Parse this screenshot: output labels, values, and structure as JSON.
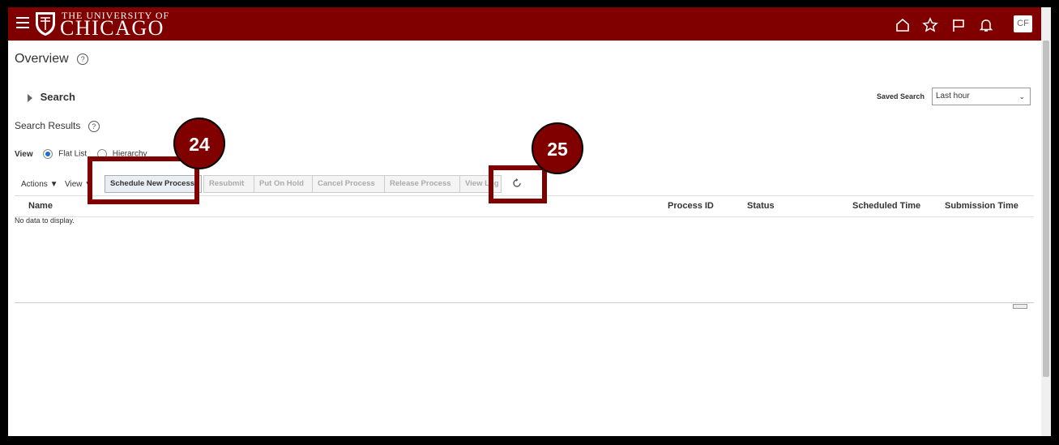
{
  "header": {
    "logo_small": "THE UNIVERSITY OF",
    "logo_big": "CHICAGO",
    "icons": [
      "home-icon",
      "star-icon",
      "flag-icon",
      "bell-icon"
    ],
    "avatar_initials": "CF",
    "brand_color": "#800000"
  },
  "page": {
    "title": "Overview",
    "help": "?"
  },
  "search": {
    "label": "Search",
    "saved_search_label": "Saved Search",
    "saved_search_value": "Last hour"
  },
  "results": {
    "title": "Search Results",
    "view_label": "View",
    "view_options": [
      {
        "label": "Flat List",
        "selected": true
      },
      {
        "label": "Hierarchy",
        "selected": false
      }
    ]
  },
  "toolbar": {
    "actions_label": "Actions",
    "view_label": "View",
    "buttons": [
      {
        "label": "Schedule New Process",
        "enabled": true
      },
      {
        "label": "Resubmit",
        "enabled": false
      },
      {
        "label": "Put On Hold",
        "enabled": false
      },
      {
        "label": "Cancel Process",
        "enabled": false
      },
      {
        "label": "Release Process",
        "enabled": false
      },
      {
        "label": "View Log",
        "enabled": false
      }
    ]
  },
  "table": {
    "columns": [
      "Name",
      "Process ID",
      "Status",
      "Scheduled Time",
      "Submission Time"
    ],
    "empty_text": "No data to display."
  },
  "callouts": {
    "first": "24",
    "second": "25"
  }
}
